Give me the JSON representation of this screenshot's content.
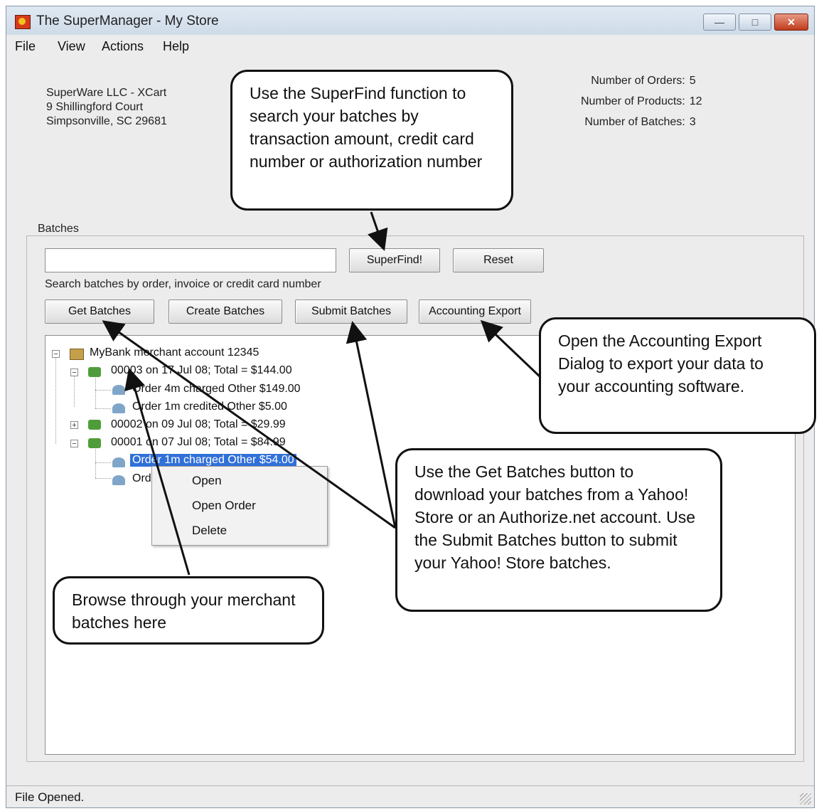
{
  "window": {
    "title": "The SuperManager - My Store"
  },
  "menu": [
    "File",
    "View",
    "Actions",
    "Help"
  ],
  "store": {
    "name": "SuperWare LLC - XCart",
    "address1": "9 Shillingford Court",
    "address2": "Simpsonville, SC 29681"
  },
  "stats": {
    "orders_label": "Number of Orders:",
    "orders_value": "5",
    "products_label": "Number of Products:",
    "products_value": "12",
    "batches_label": "Number of Batches:",
    "batches_value": "3"
  },
  "batches": {
    "group_label": "Batches",
    "search_value": "",
    "superfind_label": "SuperFind!",
    "reset_label": "Reset",
    "hint": "Search batches by order, invoice or credit card number",
    "get_label": "Get Batches",
    "create_label": "Create Batches",
    "submit_label": "Submit Batches",
    "export_label": "Accounting Export"
  },
  "tree": {
    "root": "MyBank merchant account 12345",
    "batch1": "00003 on 17 Jul 08; Total = $144.00",
    "b1_order1": "Order 4m charged Other $149.00",
    "b1_order2": "Order 1m credited Other $5.00",
    "batch2": "00002 on 09 Jul 08; Total = $29.99",
    "batch3": "00001 on 07 Jul 08; Total = $84.99",
    "b3_order1": "Order 1m charged Other $54.00",
    "b3_order2": "Order"
  },
  "context_menu": [
    "Open",
    "Open Order",
    "Delete"
  ],
  "callouts": {
    "superfind": "Use the SuperFind function to search your batches by transaction amount, credit card number  or authorization number",
    "export": "Open the Accounting Export Dialog to export your data to your accounting software.",
    "get_batches": "Use the Get Batches button to download your batches from a Yahoo! Store or an Authorize.net account.  Use the Submit Batches button to submit your Yahoo! Store batches.",
    "browse": "Browse through your merchant batches here"
  },
  "status": {
    "text": "File Opened."
  }
}
